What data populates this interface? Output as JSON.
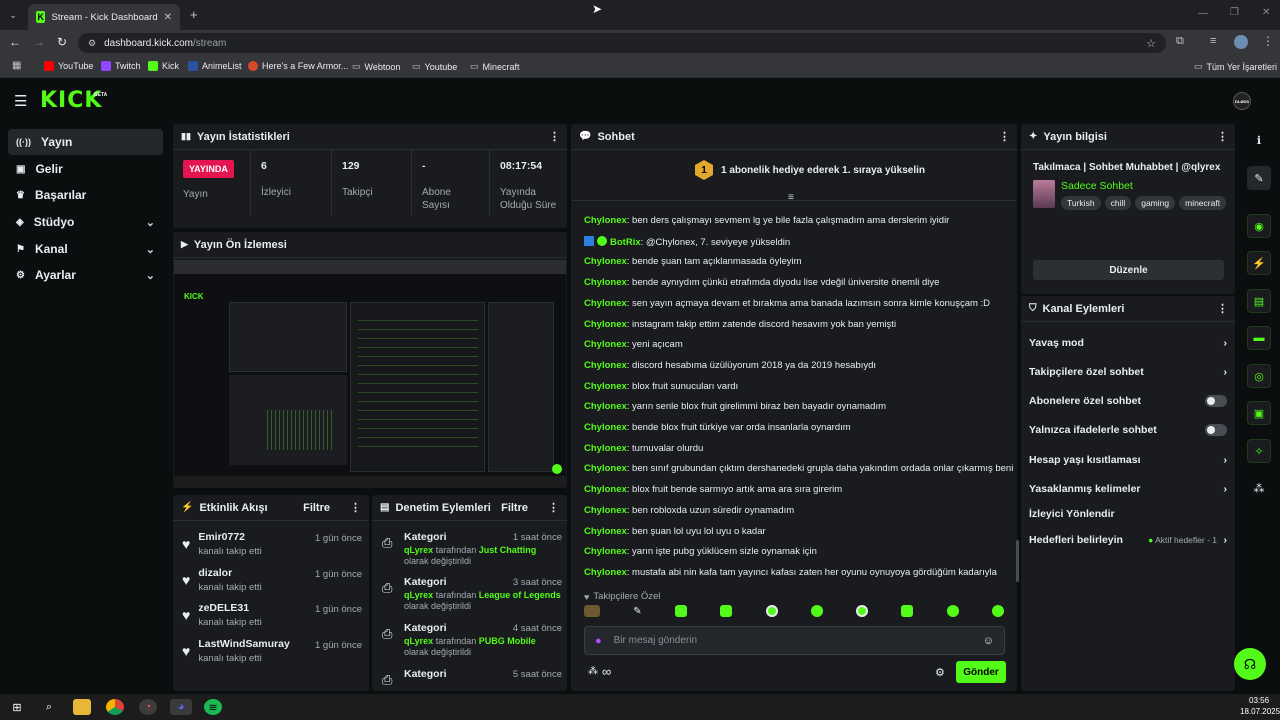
{
  "browser": {
    "tab_title": "Stream - Kick Dashboard",
    "url_host": "dashboard.kick.com",
    "url_path": "/stream",
    "bookmarks": [
      "YouTube",
      "Twitch",
      "Kick",
      "AnimeList",
      "Here's a Few Armor...",
      "Webtoon",
      "Youtube",
      "Minecraft"
    ],
    "all_bookmarks": "Tüm Yer İşaretleri"
  },
  "kick": {
    "logo": "KICK",
    "beta": "BETA",
    "avatar": "DLØDS"
  },
  "sidebar": {
    "items": [
      {
        "label": "Yayın"
      },
      {
        "label": "Gelir"
      },
      {
        "label": "Başarılar"
      },
      {
        "label": "Stüdyo"
      },
      {
        "label": "Kanal"
      },
      {
        "label": "Ayarlar"
      }
    ]
  },
  "stats": {
    "title": "Yayın İstatistikleri",
    "live_badge": "YAYINDA",
    "live_label": "Yayın",
    "items": [
      {
        "value": "6",
        "label": "İzleyici"
      },
      {
        "value": "129",
        "label": "Takipçi"
      },
      {
        "value": "-",
        "label": "Abone Sayısı"
      },
      {
        "value": "08:17:54",
        "label": "Yayında Olduğu Süre"
      }
    ]
  },
  "preview": {
    "title": "Yayın Ön İzlemesi"
  },
  "activity": {
    "title": "Etkinlik Akışı",
    "filter": "Filtre",
    "items": [
      {
        "name": "Emir0772",
        "desc": "kanalı takip etti",
        "time": "1 gün önce"
      },
      {
        "name": "dizalor",
        "desc": "kanalı takip etti",
        "time": "1 gün önce"
      },
      {
        "name": "zeDELE31",
        "desc": "kanalı takip etti",
        "time": "1 gün önce"
      },
      {
        "name": "LastWindSamuray",
        "desc": "kanalı takip etti",
        "time": "1 gün önce"
      }
    ]
  },
  "moderation": {
    "title": "Denetim Eylemleri",
    "filter": "Filtre",
    "items": [
      {
        "title": "Kategori",
        "time": "1 saat önce",
        "user": "qLyrex",
        "mid": "tarafından",
        "cat": "Just Chatting",
        "end": "olarak değiştirildi"
      },
      {
        "title": "Kategori",
        "time": "3 saat önce",
        "user": "qLyrex",
        "mid": "tarafından",
        "cat": "League of Legends",
        "end": "olarak değiştirildi"
      },
      {
        "title": "Kategori",
        "time": "4 saat önce",
        "user": "qLyrex",
        "mid": "tarafından",
        "cat": "PUBG Mobile",
        "end": "olarak değiştirildi"
      },
      {
        "title": "Kategori",
        "time": "5 saat önce"
      }
    ]
  },
  "chat": {
    "title": "Sohbet",
    "gift_number": "1",
    "gift_banner": "1 abonelik hediye ederek 1. sıraya yükselin",
    "messages": [
      {
        "user": "Chylonex",
        "text": "ben ders çalışmayı sevmem lg ye bile fazla çalışmadım ama derslerim iyidir"
      },
      {
        "user": "BotRix",
        "text": "@Chylonex, 7. seviyeye yükseldin"
      },
      {
        "user": "Chylonex",
        "text": "bende şuan tam açıklanmasada öyleyim"
      },
      {
        "user": "Chylonex",
        "text": "bende aynıydım çünkü etrafımda diyodu lise vdeğil üniversite önemli diye"
      },
      {
        "user": "Chylonex",
        "text": "sen yayın açmaya devam et bırakma ama banada lazımsın sonra kimle konuşçam :D"
      },
      {
        "user": "Chylonex",
        "text": "instagram takip ettim zatende discord hesavım yok ban yemişti"
      },
      {
        "user": "Chylonex",
        "text": "yeni açıcam"
      },
      {
        "user": "Chylonex",
        "text": "discord hesabıma üzülüyorum 2018 ya da 2019 hesabıydı"
      },
      {
        "user": "Chylonex",
        "text": "blox fruit sunucuları vardı"
      },
      {
        "user": "Chylonex",
        "text": "yarın senle blox fruit girelimmi biraz ben bayadır oynamadım"
      },
      {
        "user": "Chylonex",
        "text": "bende blox fruit türkiye var orda insanlarla oynardım"
      },
      {
        "user": "Chylonex",
        "text": "turnuvalar olurdu"
      },
      {
        "user": "Chylonex",
        "text": "ben sınıf grubundan çıktım dershanedeki grupla daha yakındım ordada onlar çıkarmış beni"
      },
      {
        "user": "Chylonex",
        "text": "blox fruit bende sarmıyo artık ama ara sıra girerim"
      },
      {
        "user": "Chylonex",
        "text": "ben robloxda uzun süredir oynamadım"
      },
      {
        "user": "Chylonex",
        "text": "ben şuan lol uyu lol uyu o kadar"
      },
      {
        "user": "Chylonex",
        "text": "yarın işte pubg yüklücem sizle oynamak için"
      },
      {
        "user": "Chylonex",
        "text": "mustafa abi nin kafa tam yayıncı kafası zaten her oyunu oynuyoya gördüğüm kadarıyla"
      }
    ],
    "followers_only": "Takipçilere Özel",
    "placeholder": "Bir mesaj gönderin",
    "send": "Gönder",
    "infinity": "∞"
  },
  "stream_info": {
    "title": "Yayın bilgisi",
    "stream_title": "Takılmaca | Sohbet Muhabbet | @qlyrex",
    "category": "Sadece Sohbet",
    "tags": [
      "Turkish",
      "chill",
      "gaming",
      "minecraft"
    ],
    "edit": "Düzenle"
  },
  "channel_actions": {
    "title": "Kanal Eylemleri",
    "items": [
      {
        "label": "Yavaş mod"
      },
      {
        "label": "Takipçilere özel sohbet"
      },
      {
        "label": "Abonelere özel sohbet"
      },
      {
        "label": "Yalnızca ifadelerle sohbet"
      },
      {
        "label": "Hesap yaşı kısıtlaması"
      },
      {
        "label": "Yasaklanmış kelimeler"
      },
      {
        "label": "İzleyici Yönlendir"
      },
      {
        "label": "Hedefleri belirleyin",
        "extra": "Aktif hedefler - 1"
      }
    ]
  },
  "taskbar": {
    "time": "03:56",
    "date": "18.07.2025"
  },
  "colors": {
    "accent": "#53fc18",
    "live": "#e3164f",
    "panel": "#191b1f",
    "bg": "#0b0e0f"
  }
}
